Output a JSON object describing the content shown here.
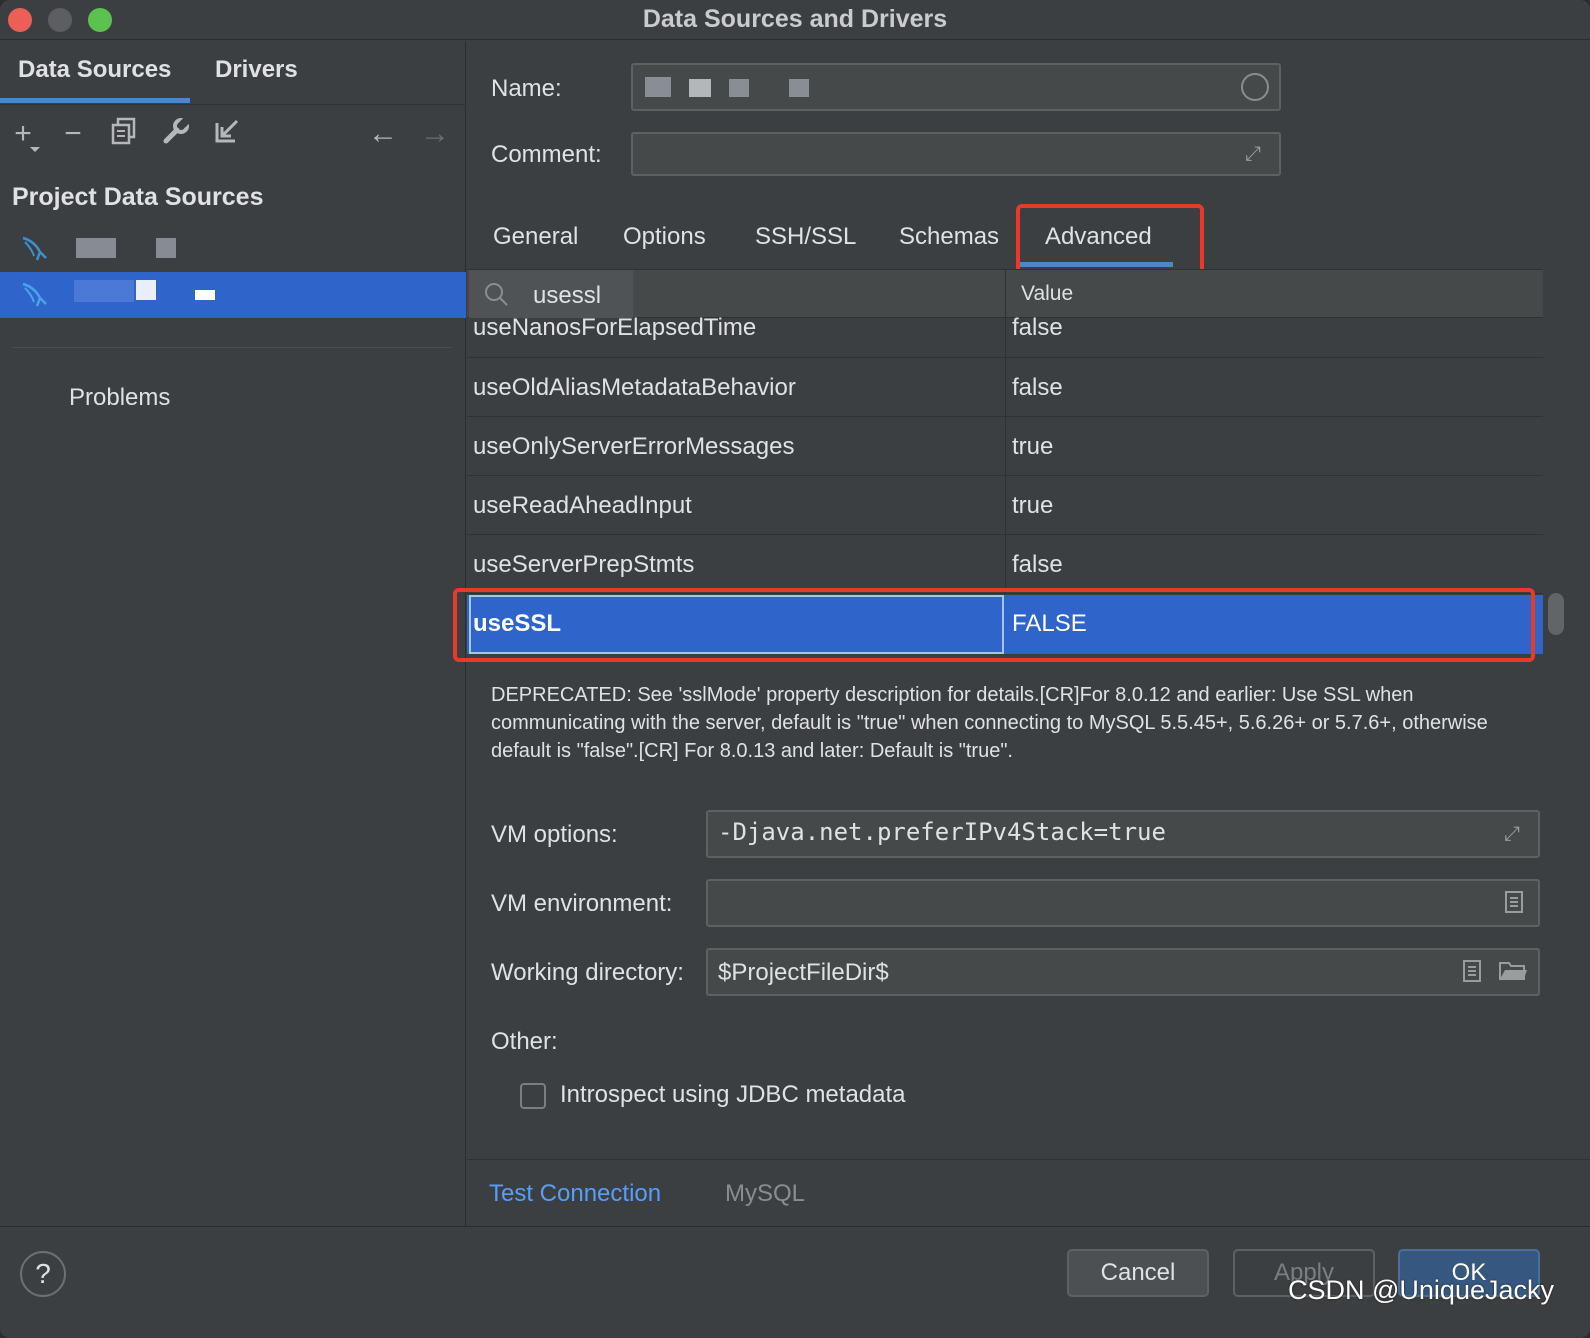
{
  "window": {
    "title": "Data Sources and Drivers"
  },
  "left": {
    "tabs": [
      {
        "label": "Data Sources"
      },
      {
        "label": "Drivers"
      }
    ],
    "toolbar": {
      "add": "+",
      "remove": "−",
      "back": "←",
      "forward": "→"
    },
    "section_title": "Project Data Sources",
    "problems_label": "Problems"
  },
  "right": {
    "name_label": "Name:",
    "comment_label": "Comment:",
    "tabs": [
      {
        "label": "General"
      },
      {
        "label": "Options"
      },
      {
        "label": "SSH/SSL"
      },
      {
        "label": "Schemas"
      },
      {
        "label": "Advanced"
      }
    ],
    "active_tab": "Advanced",
    "table": {
      "search_value": "usessl",
      "value_header": "Value",
      "rows": [
        {
          "key": "useNanosForElapsedTime",
          "value": "false"
        },
        {
          "key": "useOldAliasMetadataBehavior",
          "value": "false"
        },
        {
          "key": "useOnlyServerErrorMessages",
          "value": "true"
        },
        {
          "key": "useReadAheadInput",
          "value": "true"
        },
        {
          "key": "useServerPrepStmts",
          "value": "false"
        },
        {
          "key": "useSSL",
          "value": "FALSE",
          "selected": true
        }
      ]
    },
    "description": "DEPRECATED: See 'sslMode' property description for details.[CR]For 8.0.12 and earlier: Use SSL when communicating with the server, default is \"true\" when connecting to MySQL 5.5.45+, 5.6.26+ or 5.7.6+, otherwise default is \"false\".[CR] For 8.0.13 and later: Default is \"true\".",
    "vm_options_label": "VM options:",
    "vm_options_value": "-Djava.net.preferIPv4Stack=true",
    "vm_env_label": "VM environment:",
    "working_dir_label": "Working directory:",
    "working_dir_value": "$ProjectFileDir$",
    "other_label": "Other:",
    "introspect_label": "Introspect using JDBC metadata",
    "introspect_checked": false,
    "test_connection_label": "Test Connection",
    "driver_label": "MySQL"
  },
  "bottom": {
    "help": "?",
    "cancel": "Cancel",
    "apply": "Apply",
    "ok": "OK",
    "watermark": "CSDN @UniqueJacky"
  },
  "colors": {
    "selection": "#2f65ca",
    "highlight_box": "#e83a2c",
    "link": "#589df6",
    "accent": "#4a88c7"
  }
}
